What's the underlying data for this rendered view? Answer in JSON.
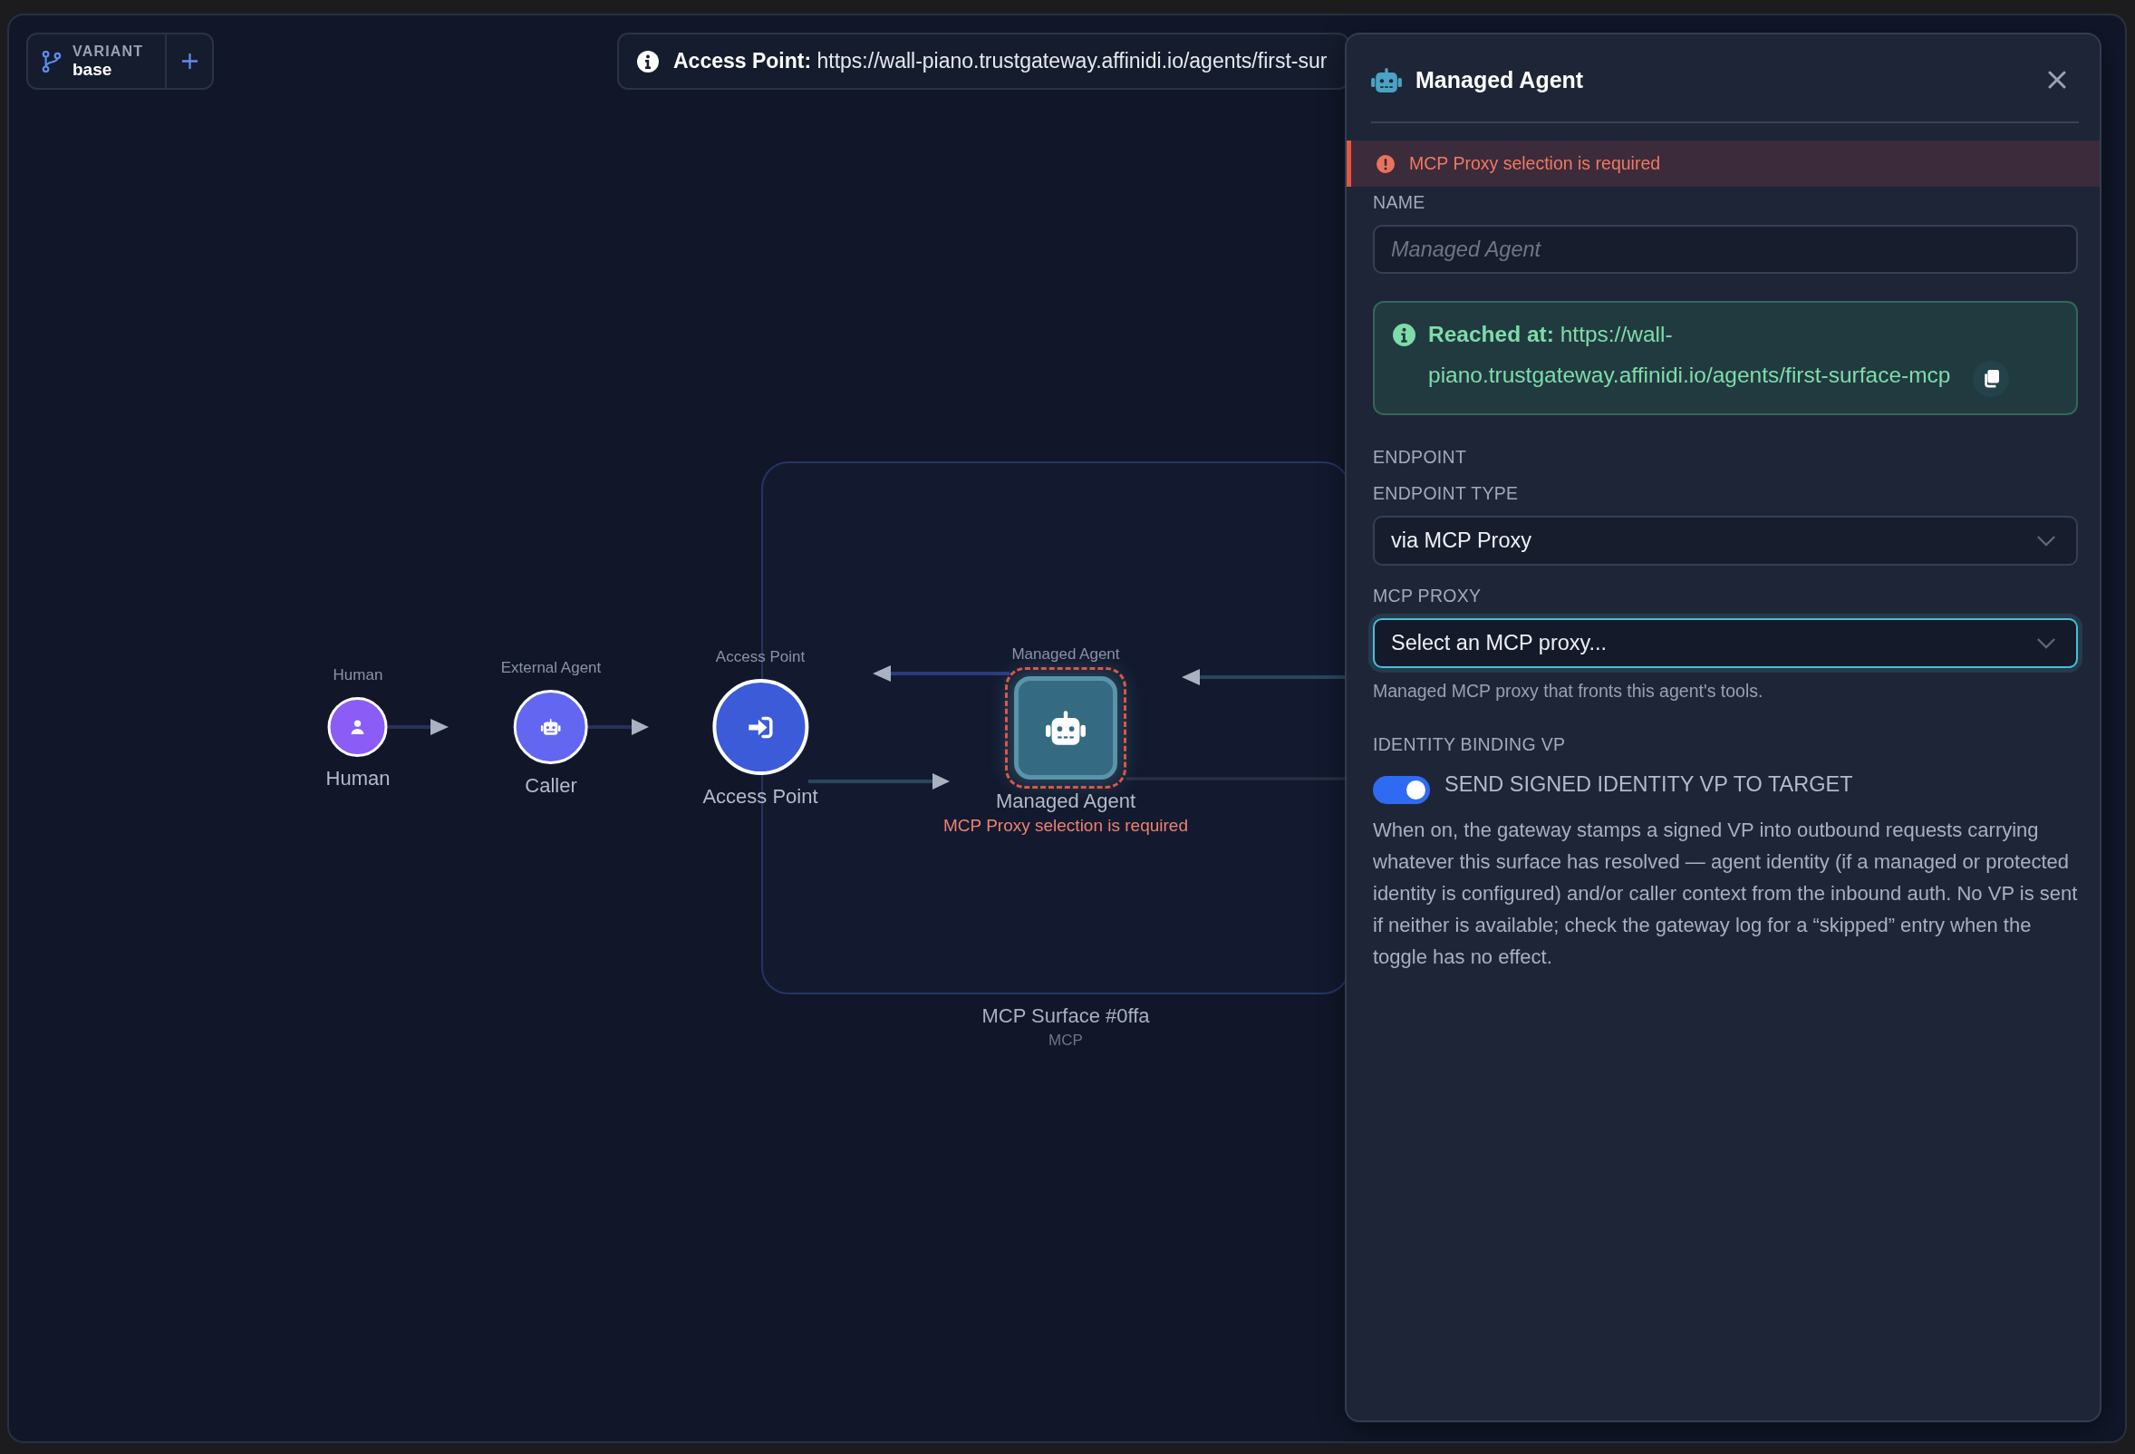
{
  "toolbar": {
    "variant": {
      "label": "VARIANT",
      "value": "base"
    }
  },
  "access_point_bar": {
    "text": "**Access Point:** https://wall-piano.trustgateway.affinidi.io/agents/first-sur"
  },
  "canvas": {
    "group": {
      "title": "MCP Surface #0ffa",
      "subtitle": "MCP"
    },
    "nodes": [
      {
        "kind": "human",
        "caption": "Human",
        "label": "Human",
        "selected": false
      },
      {
        "kind": "agent",
        "caption": "External Agent",
        "label": "Caller",
        "selected": false
      },
      {
        "kind": "access_point",
        "caption": "Access Point",
        "label": "Access Point",
        "selected": false
      },
      {
        "kind": "managed_agent",
        "caption": "Managed Agent",
        "label": "Managed Agent",
        "error": "MCP Proxy selection is required",
        "selected": true
      }
    ]
  },
  "panel": {
    "title": "Managed Agent",
    "alert": "MCP Proxy selection is required",
    "fields": [
      {
        "kind": "text",
        "label": "NAME",
        "placeholder": "Managed Agent"
      },
      {
        "kind": "info",
        "text": "**Reached at:** https://wall-piano.trustgateway.affinidi.io/agents/first-surface-mcp"
      },
      {
        "kind": "heading",
        "label": "ENDPOINT"
      },
      {
        "kind": "select",
        "label": "ENDPOINT TYPE",
        "value": "via MCP Proxy",
        "focused": false
      },
      {
        "kind": "select",
        "label": "MCP PROXY",
        "value": "Select an MCP proxy...",
        "focused": true,
        "help": "Managed MCP proxy that fronts this agent's tools."
      },
      {
        "kind": "toggle",
        "label": "IDENTITY BINDING VP",
        "toggle_label": "SEND SIGNED IDENTITY VP TO TARGET",
        "on": true,
        "description": "When on, the gateway stamps a signed VP into outbound requests carrying whatever this surface has resolved — agent identity (if a managed or protected identity is configured) and/or caller context from the inbound auth. No VP is sent if neither is available; check the gateway log for a “skipped” entry when the toggle has no effect."
      }
    ]
  }
}
